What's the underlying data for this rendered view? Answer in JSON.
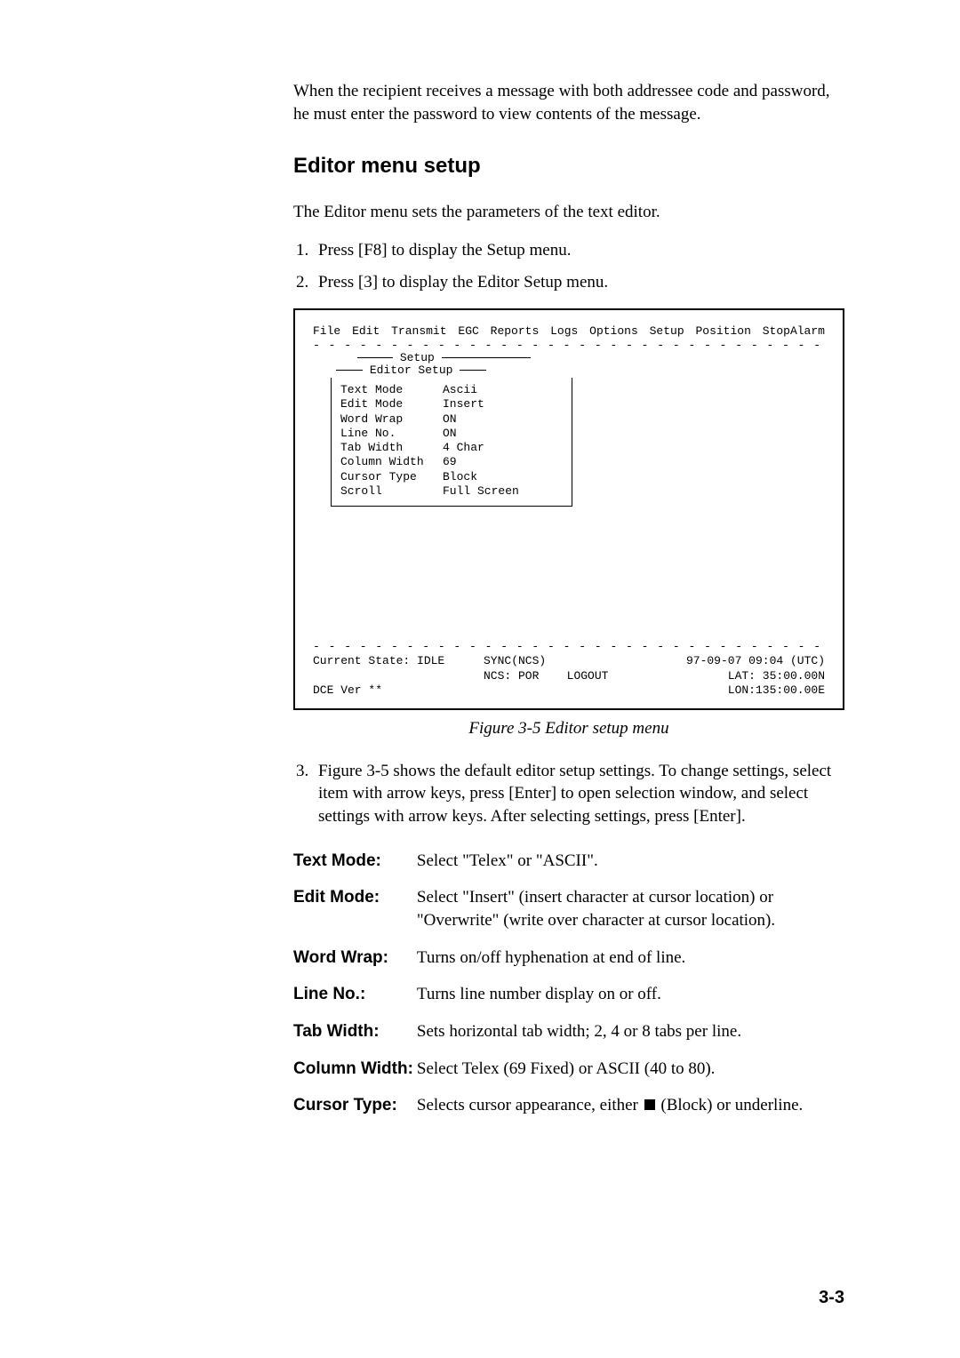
{
  "intro": "When the recipient receives a message with both addressee code and password, he must enter the password to view contents of the message.",
  "heading": "Editor menu setup",
  "lead": "The Editor menu sets the parameters of the text editor.",
  "steps": {
    "s1": "Press [F8] to display the Setup menu.",
    "s2": "Press [3] to display the Editor Setup menu.",
    "s3": "Figure 3-5 shows the default editor setup settings. To change settings, select item with arrow keys, press [Enter] to open selection window, and select settings with arrow keys. After selecting settings, press [Enter]."
  },
  "figure": {
    "menubar": [
      "File",
      "Edit",
      "Transmit",
      "EGC",
      "Reports",
      "Logs",
      "Options",
      "Setup",
      "Position",
      "StopAlarm"
    ],
    "outer_title": "Setup",
    "inner_title": "Editor Setup",
    "rows": [
      {
        "k": "Text Mode",
        "v": "Ascii"
      },
      {
        "k": "Edit Mode",
        "v": "Insert"
      },
      {
        "k": "Word Wrap",
        "v": "ON"
      },
      {
        "k": "Line No.",
        "v": "ON"
      },
      {
        "k": "Tab Width",
        "v": "4 Char"
      },
      {
        "k": "Column Width",
        "v": "69"
      },
      {
        "k": "Cursor Type",
        "v": "Block"
      },
      {
        "k": "Scroll",
        "v": "Full Screen"
      }
    ],
    "status": {
      "state": "Current State: IDLE",
      "sync": "SYNC(NCS)",
      "datetime": "97-09-07 09:04 (UTC)",
      "ncs": "NCS: POR",
      "logout": "LOGOUT",
      "lat": "LAT:  35:00.00N",
      "dce": "DCE Ver **",
      "lon": "LON:135:00.00E"
    },
    "caption": "Figure 3-5 Editor setup menu"
  },
  "defs": {
    "text_mode": {
      "term": "Text Mode:",
      "desc": "Select \"Telex\" or \"ASCII\"."
    },
    "edit_mode": {
      "term": "Edit Mode:",
      "desc": "Select \"Insert\" (insert character at cursor location) or \"Overwrite\" (write over character at cursor location)."
    },
    "word_wrap": {
      "term": "Word Wrap:",
      "desc": "Turns on/off hyphenation at end of line."
    },
    "line_no": {
      "term": "Line No.:",
      "desc": "Turns line number display on or off."
    },
    "tab_width": {
      "term": "Tab Width:",
      "desc": "Sets horizontal tab width; 2, 4 or 8 tabs per line."
    },
    "col_width": {
      "term": "Column Width:",
      "desc": "Select Telex (69 Fixed) or ASCII (40 to 80)."
    },
    "cursor_type": {
      "term": "Cursor Type:",
      "desc_a": "Selects cursor appearance, either ",
      "desc_b": " (Block) or underline."
    }
  },
  "page_number": "3-3"
}
